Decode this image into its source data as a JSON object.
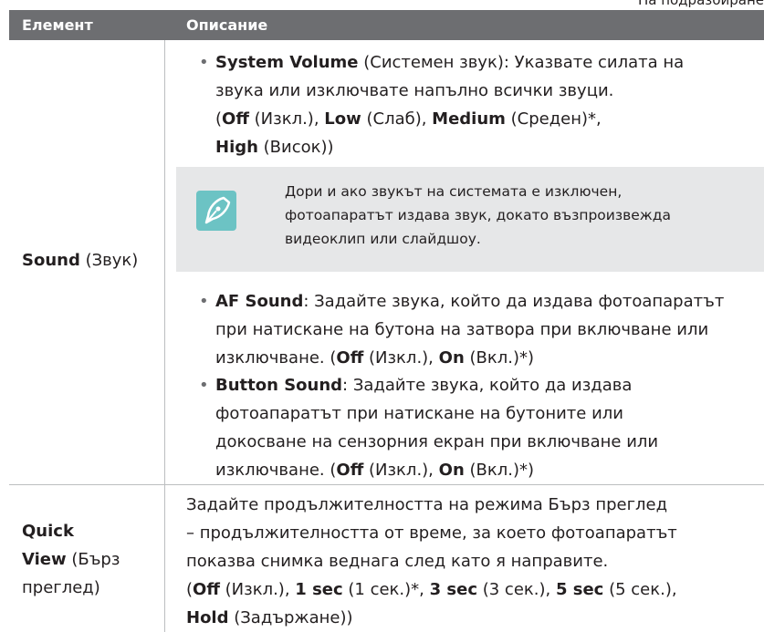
{
  "page": {
    "top_right_text": "На подразбиране"
  },
  "table": {
    "header": {
      "col1": "Елемент",
      "col2": "Описание"
    },
    "sound": {
      "label_bold": "Sound",
      "label_rest": " (Звук)",
      "system_volume": {
        "title": "System Volume",
        "l1_rest": " (Системен звук): Указвате силата на",
        "l2": "звука или изключвате напълно всички звуци.",
        "l3_a": "(",
        "off": "Off",
        "off_desc": " (Изкл.), ",
        "low": "Low",
        "low_desc": " (Слаб), ",
        "medium": "Medium",
        "medium_desc": " (Среден)*,",
        "high": "High",
        "high_desc": " (Висок))"
      },
      "note": {
        "l1": "Дори и ако звукът на системата е изключен,",
        "l2": "фотоапаратът издава звук, докато възпроизвежда",
        "l3": "видеоклип или слайдшоу."
      },
      "af_sound": {
        "title": "AF Sound",
        "l1_rest": ": Задайте звука, който да издава фотоапаратът",
        "l2": "при натискане на бутона на затвора при включване или",
        "l3_a": "изключване. (",
        "off": "Off",
        "off_desc": " (Изкл.), ",
        "on": "On",
        "on_desc": " (Вкл.)*)"
      },
      "button_sound": {
        "title": "Button Sound",
        "l1_rest": ": Задайте звука, който да издава",
        "l2": "фотоапаратът при натискане на бутоните или",
        "l3": "докосване на сензорния екран при включване или",
        "l4_a": "изключване. (",
        "off": "Off",
        "off_desc": " (Изкл.), ",
        "on": "On",
        "on_desc": " (Вкл.)*)"
      }
    },
    "quick_view": {
      "label_l1": "Quick",
      "label_l2_bold": "View",
      "label_l2_rest": " (Бърз",
      "label_l3": "преглед)",
      "l1": "Задайте продължителността на режима Бърз преглед",
      "l2": "– продължителността от време, за което фотоапаратът",
      "l3": "показва снимка веднага след като я направите.",
      "l4_a": "(",
      "off": "Off",
      "off_desc": " (Изкл.), ",
      "s1": "1 sec",
      "s1_desc": " (1 сек.)*, ",
      "s3": "3 sec",
      "s3_desc": " (3 сек.), ",
      "s5": "5 sec",
      "s5_desc": " (5 сек.),",
      "hold": "Hold",
      "hold_desc": " (Задържане))"
    }
  },
  "colors": {
    "header_bg": "#6d6e71",
    "note_bg": "#e6e7e8",
    "note_icon": "#6cc3c4",
    "border": "#bcbec0"
  },
  "icons": {
    "note": "pen-nib-icon"
  }
}
